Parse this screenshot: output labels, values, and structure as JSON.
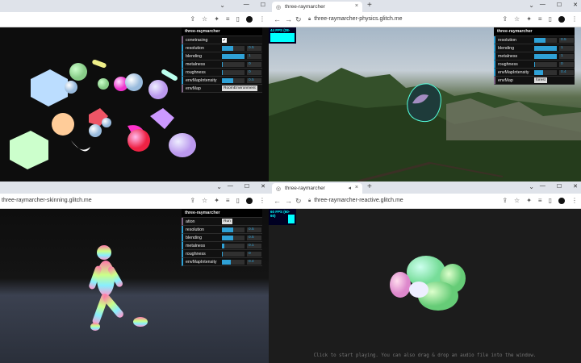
{
  "windows": {
    "top_left": {
      "tab_title": "",
      "url": "",
      "gui": {
        "title": "three-raymarcher",
        "rows": [
          {
            "label": "conetracing",
            "kind": "checkbox",
            "checked": true
          },
          {
            "label": "resolution",
            "kind": "slider",
            "value": "0.5",
            "fraction": 0.5
          },
          {
            "label": "blending",
            "kind": "slider",
            "value": "1",
            "fraction": 1.0
          },
          {
            "label": "metalness",
            "kind": "slider",
            "value": "0",
            "fraction": 0.0
          },
          {
            "label": "roughness",
            "kind": "slider",
            "value": "0",
            "fraction": 0.0
          },
          {
            "label": "envMapIntensity",
            "kind": "slider",
            "value": "0.5",
            "fraction": 0.5
          },
          {
            "label": "envMap",
            "kind": "select",
            "value": "RoomEnvironment"
          }
        ]
      }
    },
    "top_right": {
      "tab_title": "three-raymarcher",
      "url": "three-raymarcher-physics.glitch.me",
      "stats": "44 FPS (28-61)",
      "gui": {
        "title": "three-raymarcher",
        "rows": [
          {
            "label": "resolution",
            "kind": "slider",
            "value": "0.5",
            "fraction": 0.5
          },
          {
            "label": "blending",
            "kind": "slider",
            "value": "1",
            "fraction": 1.0
          },
          {
            "label": "metalness",
            "kind": "slider",
            "value": "1",
            "fraction": 1.0
          },
          {
            "label": "roughness",
            "kind": "slider",
            "value": "0",
            "fraction": 0.0
          },
          {
            "label": "envMapIntensity",
            "kind": "slider",
            "value": "0.4",
            "fraction": 0.4
          },
          {
            "label": "envMap",
            "kind": "select",
            "value": "forest"
          }
        ]
      }
    },
    "bottom_left": {
      "tab_title": "",
      "url": "three-raymarcher-skinning.glitch.me",
      "gui": {
        "title": "three-raymarcher",
        "rows": [
          {
            "label": "ation",
            "kind": "select",
            "value": "Run"
          },
          {
            "label": "resolution",
            "kind": "slider",
            "value": "0.5",
            "fraction": 0.5
          },
          {
            "label": "blending",
            "kind": "slider",
            "value": "0.5",
            "fraction": 0.5
          },
          {
            "label": "metalness",
            "kind": "slider",
            "value": "0.1",
            "fraction": 0.1
          },
          {
            "label": "roughness",
            "kind": "slider",
            "value": "0",
            "fraction": 0.0
          },
          {
            "label": "envMapIntensity",
            "kind": "slider",
            "value": "0.4",
            "fraction": 0.4
          }
        ]
      }
    },
    "bottom_right": {
      "tab_title": "three-raymarcher",
      "url": "three-raymarcher-reactive.glitch.me",
      "stats": "60 FPS (60-60)",
      "hint": "Click to start playing. You can also drag & drop an audio file into the window."
    }
  },
  "icons": {
    "back": "arrow-left-icon",
    "forward": "arrow-right-icon",
    "reload": "reload-icon",
    "lock": "lock-icon",
    "share": "share-icon",
    "star": "star-icon",
    "extensions": "puzzle-icon",
    "sidepanel": "sidepanel-icon",
    "menu": "kebab-menu-icon"
  },
  "colors": {
    "gui_accent": "#2fa1d6",
    "stats_cyan": "#00ffff"
  }
}
